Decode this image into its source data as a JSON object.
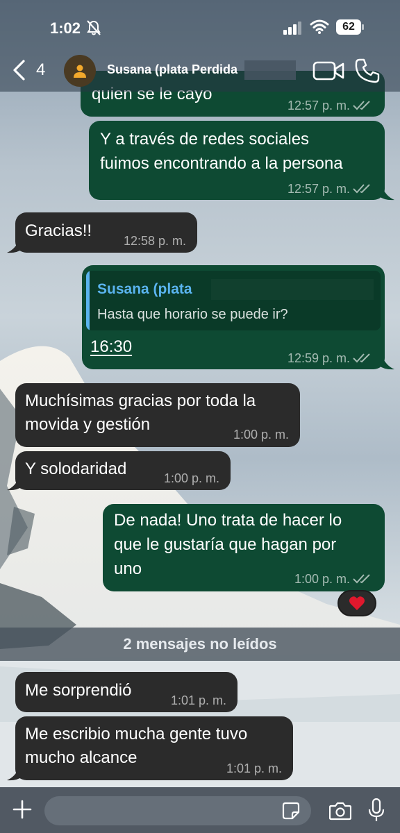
{
  "status_bar": {
    "time": "1:02",
    "battery": "62"
  },
  "header": {
    "back_count": "4",
    "contact_name": "Susana (plata Perdida"
  },
  "messages": [
    {
      "text": "quien se le cayo",
      "time": "12:57 p. m."
    },
    {
      "line1": "Y a través de redes sociales",
      "line2": "fuimos encontrando a la persona",
      "time": "12:57 p. m."
    },
    {
      "text": "Gracias!!",
      "time": "12:58 p. m."
    },
    {
      "quote_name": "Susana (plata",
      "quote_text": "Hasta que horario se puede ir?",
      "text": "16:30",
      "time": "12:59 p. m."
    },
    {
      "line1": "Muchísimas gracias por toda la",
      "line2": "movida y gestión",
      "time": "1:00 p. m."
    },
    {
      "text": "Y solodaridad",
      "time": "1:00 p. m."
    },
    {
      "line1": "De nada! Uno trata de hacer lo",
      "line2": "que le gustaría que hagan por",
      "line3": "uno",
      "time": "1:00 p. m.",
      "reaction": "❤️"
    },
    {
      "text": "Me sorprendió",
      "time": "1:01 p. m."
    },
    {
      "line1": "Me escribio mucha gente tuvo",
      "line2": "mucho alcance",
      "time": "1:01 p. m."
    }
  ],
  "unread_label": "2 mensajes no leídos",
  "colors": {
    "outgoing": "#0e4a33",
    "incoming": "#2b2b2b",
    "quote_accent": "#5ab4ef",
    "heart": "#e0182d"
  }
}
